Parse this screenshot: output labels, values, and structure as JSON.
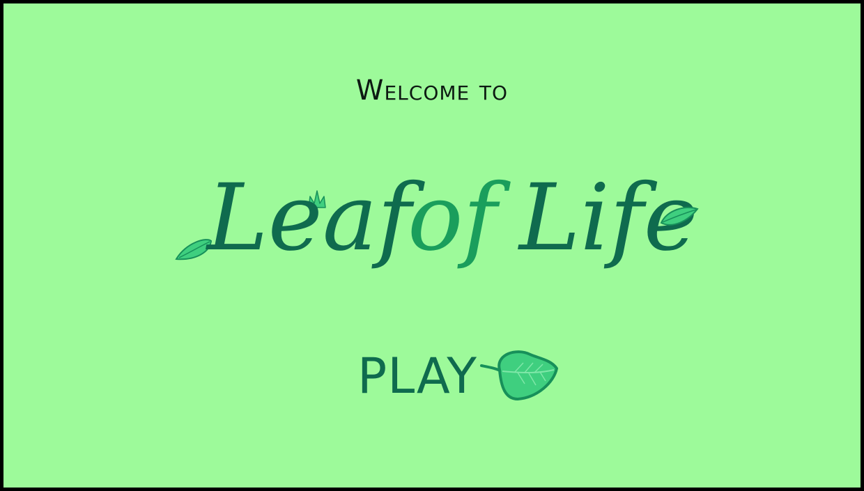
{
  "screen": {
    "welcome_text": "Welcome to",
    "title": {
      "word1": "Leaf",
      "word2": "of",
      "word3": "Life"
    },
    "play_label": "PLAY"
  },
  "colors": {
    "background": "#9dfa9a",
    "border": "#000000",
    "welcome_text": "#0d1a12",
    "title_dark_green": "#0f6b4e",
    "title_bright_green": "#1a9e5c",
    "leaf_light": "#3fcf7f",
    "leaf_dark": "#17905a",
    "play_text": "#0f6b4e"
  },
  "icons": {
    "title_left_leaf": "leaf-icon",
    "title_crown": "plant-sprout-icon",
    "title_right_leaf": "leaf-icon",
    "play_leaf": "leaf-icon"
  }
}
